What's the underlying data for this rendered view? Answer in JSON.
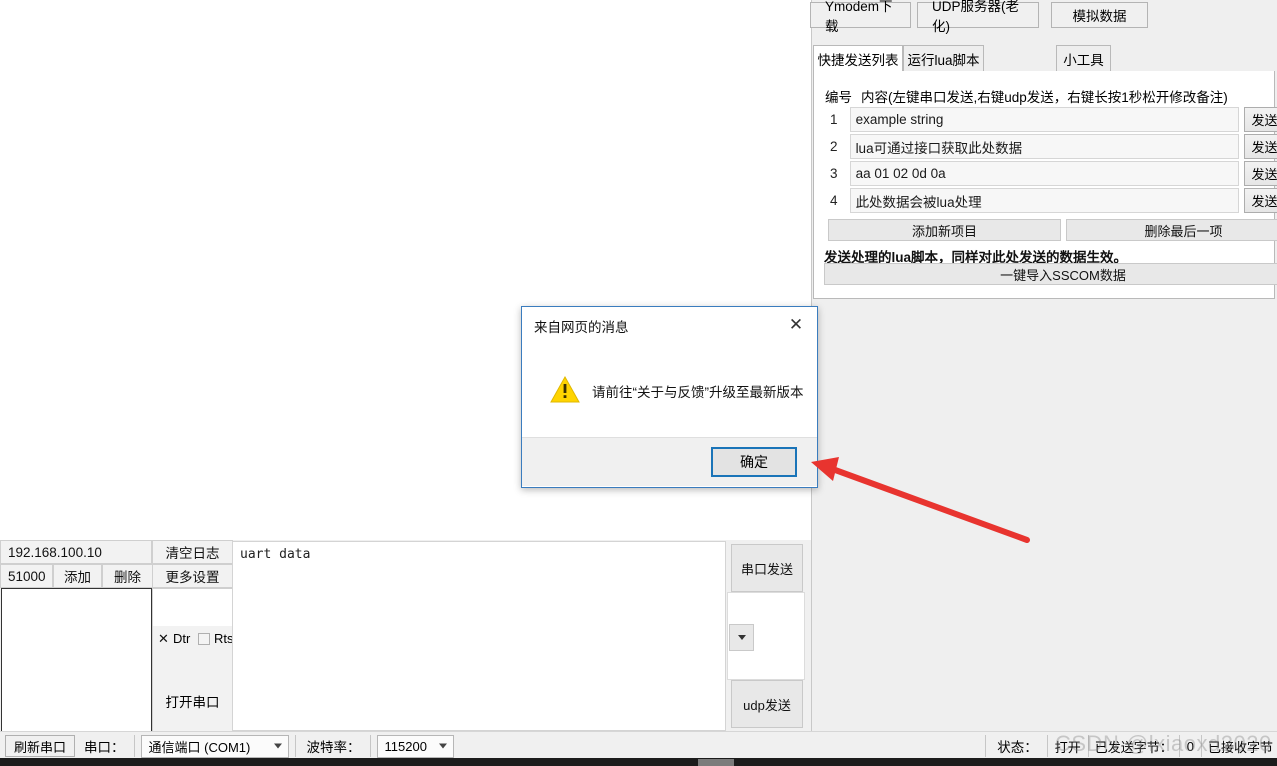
{
  "app": {
    "toolbar_buttons": [
      {
        "label": "Ymodem下载",
        "name": "ymodem-download-button"
      },
      {
        "label": "UDP服务器(老化)",
        "name": "udp-server-button"
      },
      {
        "label": "模拟数据",
        "name": "simulate-data-button"
      }
    ],
    "tabs": [
      {
        "label": "快捷发送列表",
        "active": true
      },
      {
        "label": "运行lua脚本",
        "active": false
      },
      {
        "label": "小工具",
        "active": false
      }
    ],
    "table": {
      "header_no": "编号",
      "header_content": "内容(左键串口发送,右键udp发送，右键长按1秒松开修改备注)",
      "rows": [
        {
          "no": "1",
          "content": "example string",
          "send": "发送"
        },
        {
          "no": "2",
          "content": "lua可通过接口获取此处数据",
          "send": "发送"
        },
        {
          "no": "3",
          "content": "aa 01 02 0d 0a",
          "send": "发送"
        },
        {
          "no": "4",
          "content": "此处数据会被lua处理",
          "send": "发送"
        }
      ]
    },
    "add_item_button": "添加新项目",
    "delete_last_button": "删除最后一项",
    "lua_notice": "发送处理的lua脚本，同样对此处发送的数据生效。",
    "import_sscom_button": "一键导入SSCOM数据"
  },
  "dialog": {
    "title": "来自网页的消息",
    "close_icon": "close-icon",
    "warning_icon": "warning-triangle-icon",
    "message": "请前往“关于与反馈”升级至最新版本",
    "ok_button": "确定"
  },
  "serial": {
    "ip_value": "192.168.100.10",
    "port_value": "51000",
    "add_button": "添加",
    "delete_button": "删除",
    "clear_log_button": "清空日志",
    "more_settings_button": "更多设置",
    "dtr_label": "Dtr",
    "dtr_checked": true,
    "rts_label": "Rts",
    "rts_checked": false,
    "open_port_button": "打开串口",
    "uart_text": "uart data",
    "serial_send_button": "串口发送",
    "dropdown_icon": "chevron-down-icon",
    "udp_send_button": "udp发送"
  },
  "statusbar": {
    "refresh_button": "刷新串口",
    "port_label": "串口：",
    "port_value": "通信端口 (COM1)",
    "baud_label": "波特率：",
    "baud_value": "115200",
    "status_label": "状态：",
    "status_value": "打开",
    "sent_label": "已发送字节：",
    "sent_value": "0",
    "recv_label": "已接收字节"
  },
  "watermark": {
    "text": "CSDN @lxiaoxd2020"
  },
  "colors": {
    "accent": "#1a74b8",
    "warning": "#ffd400",
    "arrow": "#e8342f",
    "panel_bg": "#efefef"
  }
}
